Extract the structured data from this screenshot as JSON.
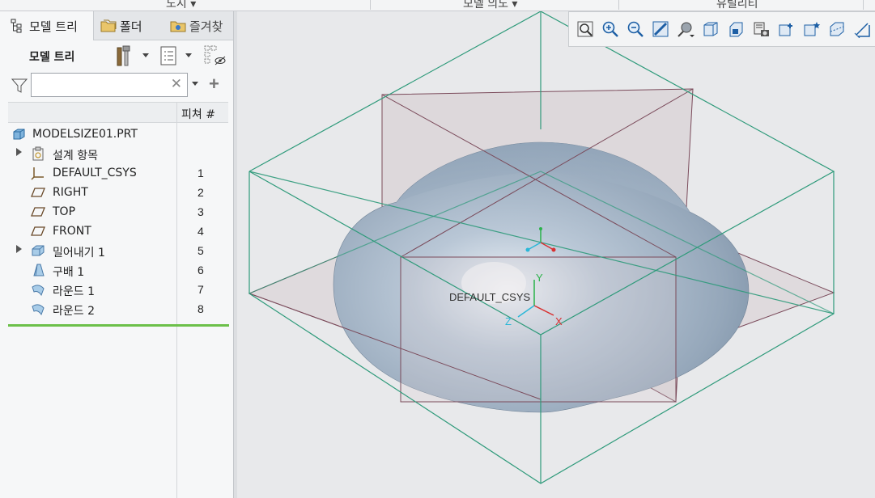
{
  "ribbon": {
    "groups": [
      "도시 ▾",
      "모델 의도 ▾",
      "유틸리티"
    ]
  },
  "tabs": [
    {
      "label": "모델 트리",
      "icon": "model-tree-icon"
    },
    {
      "label": "폴더",
      "icon": "folder-icon"
    },
    {
      "label": "즐겨찾",
      "icon": "favorites-icon"
    }
  ],
  "tree_toolbar": {
    "title": "모델 트리"
  },
  "search": {
    "value": "",
    "placeholder": ""
  },
  "columns": {
    "feature_num": "피쳐 #"
  },
  "tree": {
    "root": "MODELSIZE01.PRT",
    "items": [
      {
        "label": "설계 항목",
        "num": "",
        "icon": "design-items-icon",
        "expandable": true
      },
      {
        "label": "DEFAULT_CSYS",
        "num": "1",
        "icon": "csys-icon",
        "expandable": false
      },
      {
        "label": "RIGHT",
        "num": "2",
        "icon": "datum-plane-icon",
        "expandable": false
      },
      {
        "label": "TOP",
        "num": "3",
        "icon": "datum-plane-icon",
        "expandable": false
      },
      {
        "label": "FRONT",
        "num": "4",
        "icon": "datum-plane-icon",
        "expandable": false
      },
      {
        "label": "밀어내기 1",
        "num": "5",
        "icon": "extrude-icon",
        "expandable": true
      },
      {
        "label": "구배 1",
        "num": "6",
        "icon": "draft-icon",
        "expandable": false
      },
      {
        "label": "라운드 1",
        "num": "7",
        "icon": "round-icon",
        "expandable": false
      },
      {
        "label": "라운드 2",
        "num": "8",
        "icon": "round-icon",
        "expandable": false
      }
    ]
  },
  "viewport": {
    "csys_label": "DEFAULT_CSYS",
    "axis_labels": {
      "x": "X",
      "y": "Y",
      "z": "Z"
    },
    "toolbar": [
      "refit-icon",
      "zoom-in-icon",
      "zoom-out-icon",
      "repaint-icon",
      "display-style-icon",
      "saved-orientations-icon",
      "view-manager-icon",
      "perspective-icon",
      "annotation-display-icon",
      "datum-display-icon",
      "section-icon",
      "spin-center-icon"
    ]
  },
  "colors": {
    "green_edge": "#2e9a7a",
    "datum_plane": "#7a4a5a",
    "insert_line": "#6cc04a",
    "part_blue": "#9fb2c6"
  }
}
